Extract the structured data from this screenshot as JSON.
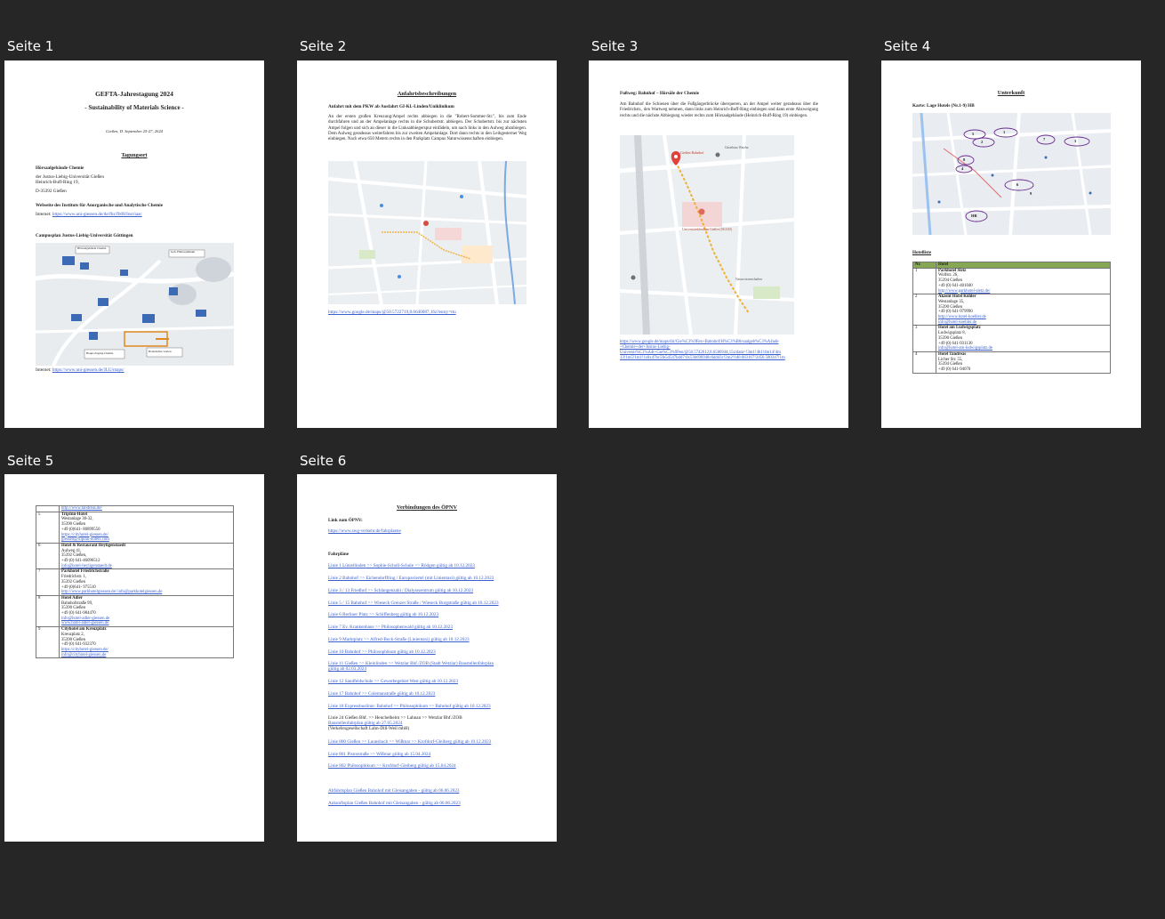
{
  "labels": [
    "Seite 1",
    "Seite 2",
    "Seite 3",
    "Seite 4",
    "Seite 5",
    "Seite 6"
  ],
  "p1": {
    "title": "GEFTA-Jahrestagung 2024",
    "subtitle": "- Sustainability of Materials Science -",
    "date": "Gießen, D. September 25-27, 2024",
    "venue_heading": "Tagungsort",
    "venue_name": "Hörsaalgebäude Chemie",
    "addr1": "der Justus-Liebig-Universität Gießen",
    "addr2": "Heinrich-Buff-Ring 19,",
    "addr3": "D-35392 Gießen",
    "website_heading": "Webseite des Instituts für Anorganische und Analytische Chemie",
    "internet_label": "Internet:",
    "internet_url": "https://www.uni-giessen.de/de/fbz/fb08/Inst/iaac",
    "campus_heading": "Campusplan Justus-Liebig-Universität Göttingen",
    "campus_url": "https://www.uni-giessen.de/JLU/maps/",
    "map_labels": [
      "Hörsaalgebäude Chemie",
      "Geb. Philosophikum",
      "Botanischer Garten",
      "Haupt-Zugang Chemie"
    ]
  },
  "p2": {
    "heading": "Anfahrtsbeschreibungen",
    "subheading": "Anfahrt mit dem PKW ab Ausfahrt GI-Kl.-Linden/Uniklinikum",
    "body": "An der ersten großen Kreuzung/Ampel rechts abbiegen in die \"Robert-Sommer-Str.\", bis zum Ende durchfahren und an der Ampelanlage rechts in die Schubertstr. abbiegen. Der Schubertstr. bis zur nächsten Ampel folgen und sich an dieser in die Linksabbiegerspur einfädeln, um nach links in den Aulweg abzubiegen. Dem Aulweg geradeaus weiterfahren bis zur zweiten Ampelanlage. Dort dann rechts in den Leihgesterner Weg einbiegen. Nach etwa 650 Metern rechts in den Parkplatz Campus Naturwissenschaften einbiegen.",
    "url": "https://www.google.de/maps/@50.5722719,8.6640087,16z?entry=ttu"
  },
  "p3": {
    "heading": "Fußweg: Bahnhof – Hörsäle der Chemie",
    "body": "Am Bahnhof die Schienen über die Fußgängerbrücke überqueren, an der Ampel weiter geradeaus über die Friedrichstr., den Wartweg nehmen, dann links zum Heinrich-Buff-Ring einbiegen und dann erste Abzweigung rechts und die nächste Abbiegung wieder rechts zum Hörsaalgebäude (Heinrich-Buff-Ring 19) einbiegen.",
    "map_labels": [
      "Gießen Bahnhof",
      "Universitätsklinikum Gießen (UKGM)",
      "Gästehaus Wetzlar",
      "Naturwissenschaften"
    ],
    "url_lines": [
      "https://www.google.de/maps/dir/Gie%C3%9Fen+Bahnhof/H%C3%B6rsaalgeb%C3%A4ude",
      "+Chemie+der+Justus-Liebig-",
      "Universit%C3%A4t+Gie%C3%9Fen/@50.5742612,8.6586944,15z/data=!3m1!4b1!4m14!4m",
      "13!1m5!1m1!1s0x47bc5fe5d547bdd7:0x53b696948c6dd43c!2m2!1d8.663167!2d50.580347!1m"
    ]
  },
  "p4": {
    "heading": "Unterkunft",
    "map_heading": "Karte: Lage Hotels (Nr.1-9) HB",
    "list_heading": "Hotelliste",
    "col_nr": "Nr.",
    "col_hotel": "Hotel",
    "map_markers": [
      "5",
      "1",
      "2",
      "7",
      "8",
      "6",
      "3",
      "4",
      "9",
      "HB"
    ],
    "rows": [
      {
        "nr": "1",
        "lines": [
          "Parkhotel Sletz",
          "Wolfstr. 26,",
          "35394 Gießen",
          "+49 (0) 641-401040"
        ],
        "links": [
          "http://www.parkhotel-sletz.de/"
        ]
      },
      {
        "nr": "2",
        "lines": [
          "Akzent Hotel Köhler",
          "Westanlage 35,",
          "35390 Gießen",
          "+49 (0) 641-979990"
        ],
        "links": [
          "http://www.hotel-koehler.de",
          "info@hotel-koehler.de"
        ]
      },
      {
        "nr": "3",
        "lines": [
          "Hotel am Ludwigsplatz",
          "Ludwigsplatz 8,",
          "35390 Gießen",
          "+49 (0) 641-931130"
        ],
        "links": [
          "info@hotel-am-ludwigsplatz.de"
        ]
      },
      {
        "nr": "4",
        "lines": [
          "Hotel Tandreas",
          "Licher Str. 55,",
          "35394 Gießen",
          "+49 (0) 641-94070"
        ],
        "links": []
      }
    ]
  },
  "p5": {
    "top_link": "http://www.tandreas.de/",
    "rows": [
      {
        "nr": "5",
        "lines": [
          "TripInn-Hotel",
          "Westanlage 30-32,",
          "35390 Gießen",
          "+49 (0)641- 80899550"
        ],
        "links": [
          "https://cityhotel-giessen.de/",
          "giessen@tripinn-hotels.com"
        ]
      },
      {
        "nr": "6",
        "lines": [
          "Hotel & Restaurant Heyligenstaedt",
          "Aulweg 41,",
          "35392 Gießen,",
          "+49 (0) 641-46096512"
        ],
        "links": [
          "info@hotel-heyligenstaedt.de"
        ]
      },
      {
        "nr": "7",
        "lines": [
          "Parkhotel Friedrichstraße",
          "Friedrichstr. 1,",
          "35392 Gießen",
          "+49 (0)641- 975510"
        ],
        "links": [
          "http://www.parkhotelgiessen.de/ info@parkhotelgiessen.de"
        ]
      },
      {
        "nr": "8",
        "lines": [
          "Hotel Adler",
          "Bahnhofstraße 99,",
          "35390 Gießen",
          "+49 (0) 641-984470"
        ],
        "links": [
          "info@hotel-adler-giessen.de",
          "www.hotel-adler-giessen.de"
        ]
      },
      {
        "nr": "9",
        "lines": [
          "Cityhotel am Kreuzplatz",
          "Kreuzplatz 2,",
          "35390 Gießen",
          "+49 (0) 641-932370"
        ],
        "links": [
          "https://cityhotel-giessen.de/",
          "info@cityhotel-giessen.de"
        ]
      }
    ]
  },
  "p6": {
    "heading": "Verbindungen des ÖPNV",
    "link_label": "Link zum ÖPNV:",
    "link_url": "https://www.swg-verkehr.de/fahrplaene",
    "fahrplaene_heading": "Fahrpläne",
    "lines": [
      "Linie 1 Lützellinden >> Sophie-Scholl-Schule >> Rödgen gültig ab 10.12.2023",
      "Linie 2 Bahnhof >> Eichendorffring / Europaviertel (mit Linientaxi) gültig ab 10.12.2023",
      "Linie 3 / 13 Friedhof >> Schlangenzahl / Dialysezentrum gültig ab 10.12.2023",
      "Linie 5 / 15 Bahnhof >> Wieseck Grenzer Straße / Wieseck Burgstraße gültig ab 10.12.2023",
      "Linie 6 Berliner Platz >> Schiffenberg gültig ab 10.12.2023",
      "Linie 7 Ev. Krankenhaus >> Philosophenwald gültig ab 10.12.2023",
      "Linie 9 Marktplatz >> Alfred-Bock-Straße (Linientaxi) gültig ab 10.12.2023",
      "Linie 10 Bahnhof >> Philosophikum gültig ab 10.12.2023",
      "Linie 11 Gießen >> Kleinlinden >> Wetzlar Bhf./ZOB (Stadt Wetzlar) Baustellenfahrplan",
      "Linie 12 Sandfeldschule >> Gewerbegebiet West gültig ab 10.12.2023",
      "Linie 17 Bahnhof >> Colemanstraße gültig ab 10.12.2023",
      "Linie 18 Expressbuslinie: Bahnhof >> Philosophikum >> Bahnhof gültig ab 10.12.2023",
      "Linie 24 Gießen Bhf. >> Heuchelheim >> Lahnau >> Wetzlar Bhf./ZOB",
      "Linie 800 Gießen >> Launsbach >> Wißmar >> Krofdorf-Gleiberg gültig ab 10.12.2023",
      "Linie 801 Pistorstraße >> Wißmar gültig ab 15.04.2024",
      "Linie 802 Philosophikum >> Krofdorf-Gleiberg gültig ab 15.04.2024"
    ],
    "line11_cont": "gültig ab 02.03.2024",
    "line24_link1": "Baustellenfahrplan gültig ab 27.05.2024",
    "line24_note": "(Verkehrsgesellschaft Lahn-Dill-Weil mbH)",
    "abfahrt": "Abfahrtsplan Gießen Bahnhof mit Gleisangaben - gültig ab 06.06.2023",
    "ankunft": "Ankunftsplan Gießen Bahnhof mit Gleisangaben - gültig ab 06.06.2023"
  }
}
